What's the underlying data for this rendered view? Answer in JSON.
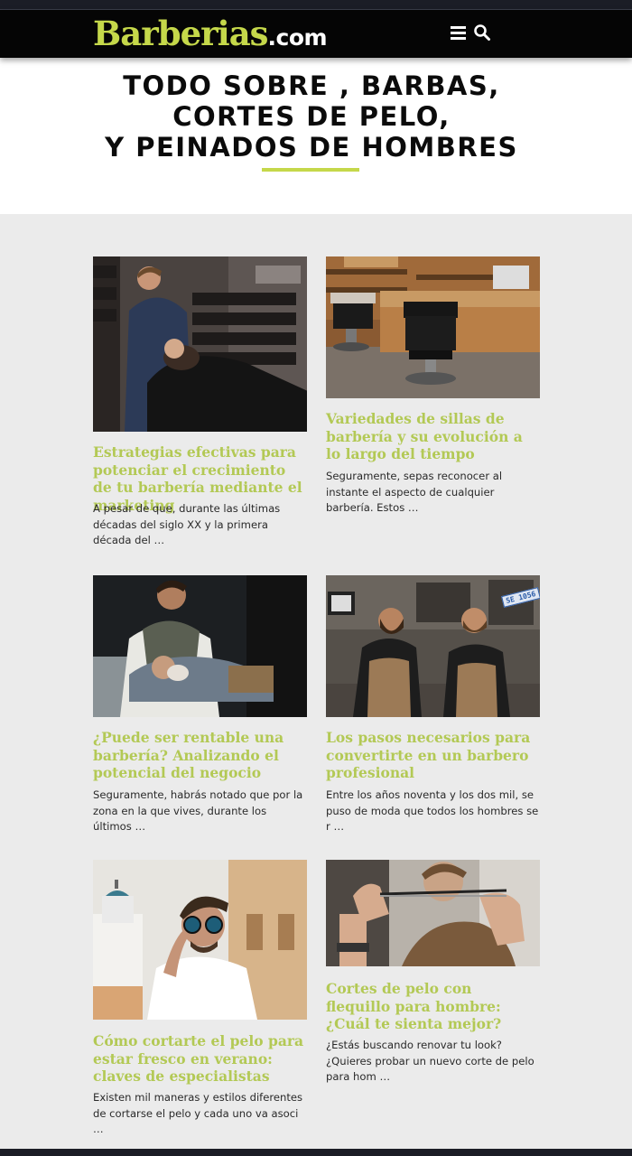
{
  "site": {
    "logo_main": "Barberias",
    "logo_suffix": ".com"
  },
  "hero": {
    "title_lines": [
      "TODO SOBRE , BARBAS,",
      "CORTES DE PELO,",
      "Y PEINADOS DE HOMBRES"
    ]
  },
  "colors": {
    "accent": "#c5d84a",
    "title_green": "#b3c955",
    "header_bg": "#050505",
    "page_bg": "#ebebeb"
  },
  "icons": [
    "menu-icon",
    "search-icon"
  ],
  "articles": [
    {
      "title": "Estrategias efectivas para potenciar el crecimiento de tu barbería mediante el marketing",
      "excerpt": "A pesar de que, durante las últimas décadas del siglo XX y la primera década del …"
    },
    {
      "title": "Variedades de sillas de barbería y su evolución a lo largo del tiempo",
      "excerpt": "Seguramente, sepas reconocer al instante el aspecto de cualquier barbería. Estos …"
    },
    {
      "title": "¿Puede ser rentable una barbería? Analizando el potencial del negocio",
      "excerpt": "Seguramente, habrás notado que por la zona en la que vives, durante los últimos …"
    },
    {
      "title": "Los pasos necesarios para convertirte en un barbero profesional",
      "excerpt": "Entre los años noventa y los dos mil, se puso de moda que todos los hombres se r …"
    },
    {
      "title": "Cómo cortarte el pelo para estar fresco en verano: claves de especialistas",
      "excerpt": "Existen mil maneras y estilos diferentes de cortarse el pelo y cada uno va asoci …"
    },
    {
      "title": "Cortes de pelo con flequillo para hombre: ¿Cuál te sienta mejor?",
      "excerpt": "¿Estás buscando renovar tu look? ¿Quieres probar un nuevo corte de pelo para hom …"
    }
  ],
  "photo_badge": "SE 1056"
}
